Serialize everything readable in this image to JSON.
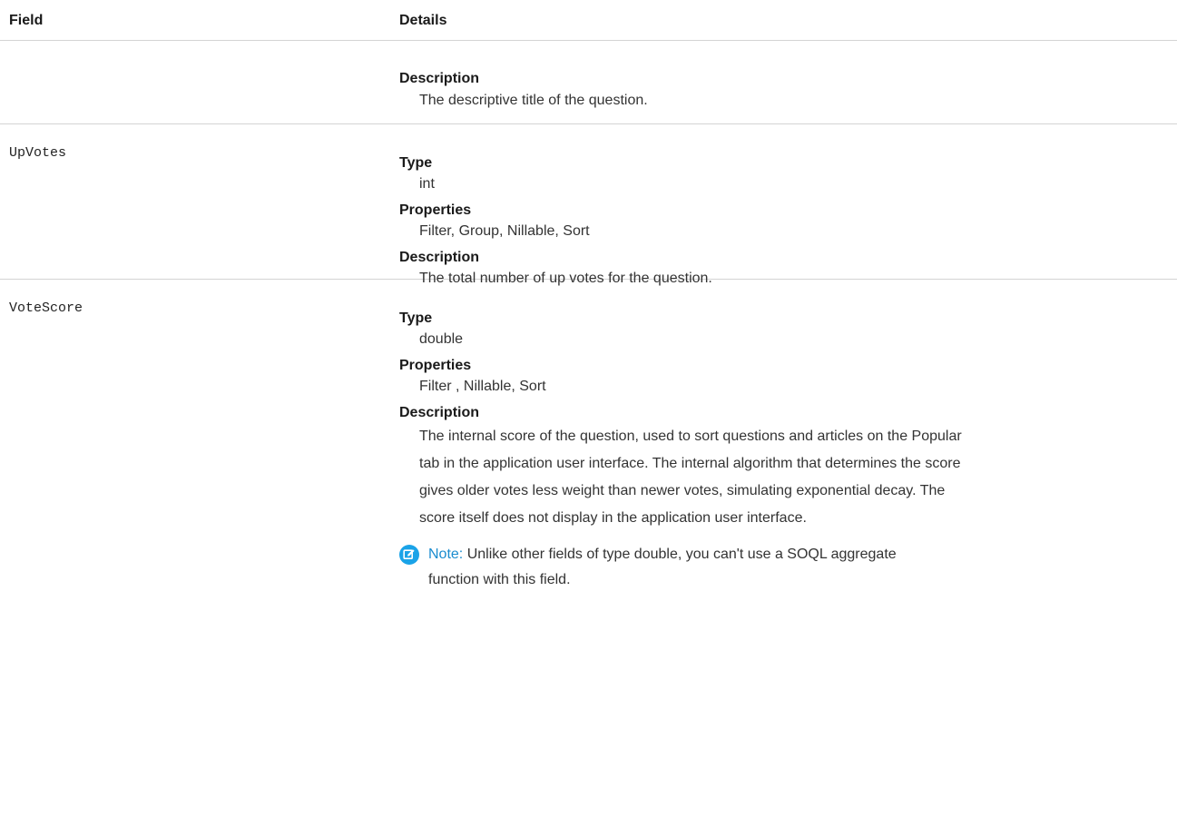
{
  "header": {
    "field": "Field",
    "details": "Details"
  },
  "rows": [
    {
      "field_name": "",
      "description_label": "Description",
      "description": "The descriptive title of the question."
    },
    {
      "field_name": "UpVotes",
      "type_label": "Type",
      "type": "int",
      "properties_label": "Properties",
      "properties": "Filter, Group, Nillable, Sort",
      "description_label": "Description",
      "description": "The total number of up votes for the question."
    },
    {
      "field_name": "VoteScore",
      "type_label": "Type",
      "type": "double",
      "properties_label": "Properties",
      "properties": "Filter , Nillable, Sort",
      "description_label": "Description",
      "description_lines": [
        "The internal score of the question, used to sort questions and articles on the Popular",
        "tab in the application user interface. The internal algorithm that determines the score",
        "gives older votes less weight than newer votes, simulating exponential decay. The",
        "score itself does not display in the application user interface."
      ],
      "note": {
        "icon": "note-edit-icon",
        "label": "Note:",
        "text": " Unlike other fields of type double, you can't use a SOQL aggregate",
        "text_line2": "function with this field."
      }
    }
  ],
  "colors": {
    "note_icon": "#1aa3e8",
    "note_label": "#1a8ccf",
    "divider": "#d4d4d4"
  }
}
